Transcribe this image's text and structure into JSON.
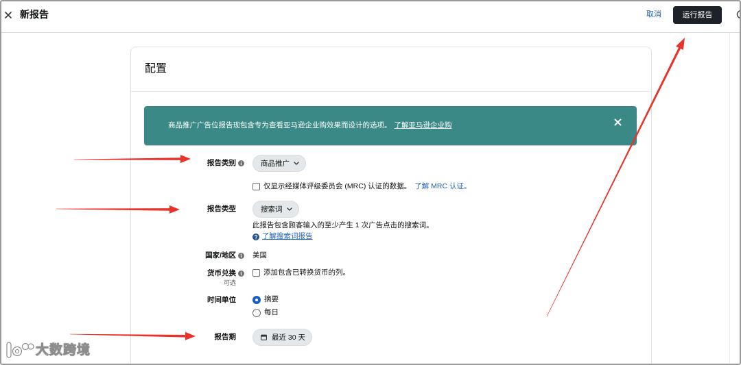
{
  "header": {
    "title": "新报告",
    "cancel_label": "取消",
    "run_label": "运行报告"
  },
  "config": {
    "title": "配置",
    "banner": {
      "text": "商品推广广告位报告现包含专为查看亚马逊企业购效果而设计的选项。",
      "link_label": "了解亚马逊企业购"
    },
    "report_category": {
      "label": "报告类别",
      "value": "商品推广",
      "mrc_checkbox": {
        "label": "仅显示经媒体评级委员会 (MRC) 认证的数据。",
        "link_label": "了解 MRC 认证。",
        "checked": false
      }
    },
    "report_type": {
      "label": "报告类型",
      "value": "搜索词",
      "description": "此报告包含顾客输入的至少产生 1 次广告点击的搜索词。",
      "help_link_label": "了解搜索词报告"
    },
    "country": {
      "label": "国家/地区",
      "value": "美国"
    },
    "currency": {
      "label": "货币兑换",
      "optional_label": "可选",
      "checkbox_label": "添加包含已转换货币的列。",
      "checked": false
    },
    "time_unit": {
      "label": "时间单位",
      "options": [
        "摘要",
        "每日"
      ],
      "selected_index": 0
    },
    "report_period": {
      "label": "报告期",
      "value": "最近 30 天"
    }
  },
  "watermark": {
    "text": "大数跨境"
  },
  "icons": {
    "close": "close-icon",
    "info": "info-icon",
    "dropdown": "chevron-down-icon",
    "help": "question-circle-icon",
    "calendar": "calendar-icon",
    "edge": "circle-icon"
  },
  "colors": {
    "banner": "#3a8986",
    "run_button": "#1d2228",
    "link": "#2162b9",
    "radio_selected": "#1a5fbf",
    "annotation_arrow": "#e8322c"
  }
}
